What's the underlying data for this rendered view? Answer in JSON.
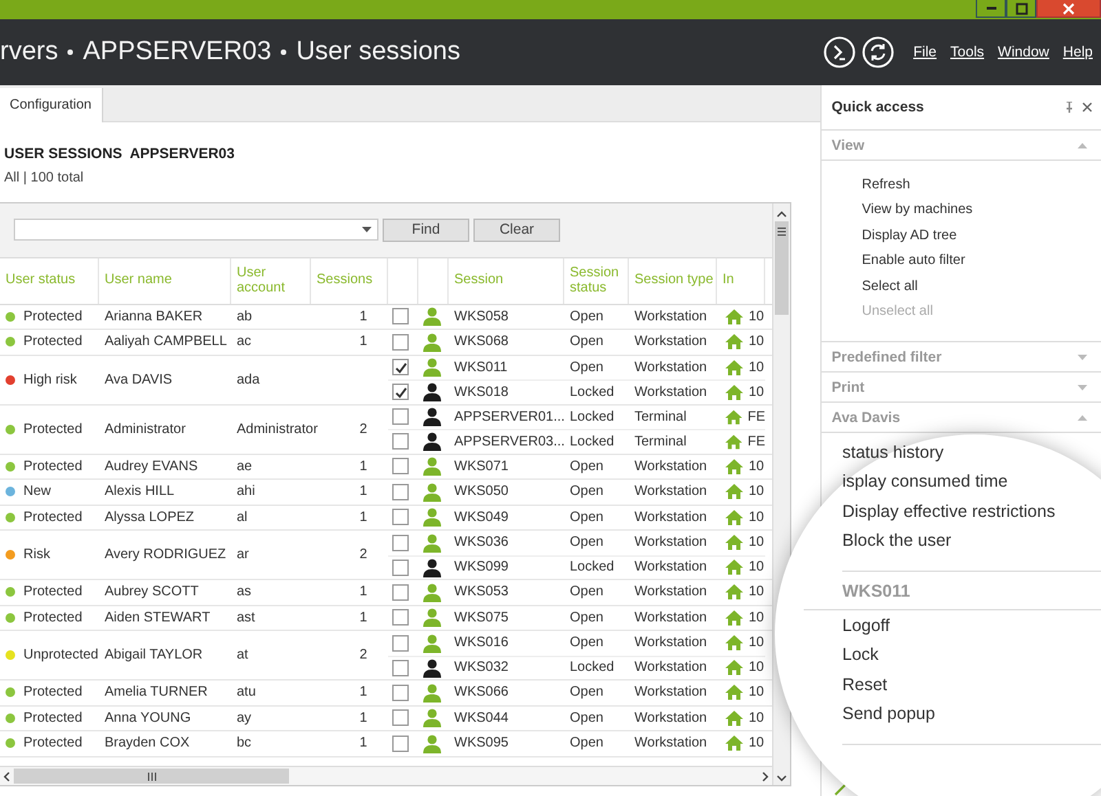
{
  "window": {
    "breadcrumb": [
      "rvers",
      "APPSERVER03",
      "User sessions"
    ],
    "menu": [
      "File",
      "Tools",
      "Window",
      "Help"
    ]
  },
  "tabs": [
    {
      "label": "Configuration",
      "selected": true
    }
  ],
  "heading": {
    "title": "USER SESSIONS",
    "server": "APPSERVER03",
    "summary": "All | 100 total"
  },
  "filter": {
    "find": "Find",
    "clear": "Clear"
  },
  "table": {
    "columns": [
      "User status",
      "User name",
      "User account",
      "Sessions",
      "Session",
      "Session status",
      "Session type",
      "In"
    ],
    "users": [
      {
        "status": "Protected",
        "color": "#8cc63f",
        "name": "Arianna BAKER",
        "account": "ab",
        "sessions_count": "1",
        "sessions": [
          {
            "checked": false,
            "locked": false,
            "session": "WKS058",
            "status": "Open",
            "type": "Workstation",
            "in": "10"
          }
        ]
      },
      {
        "status": "Protected",
        "color": "#8cc63f",
        "name": "Aaliyah CAMPBELL",
        "account": "ac",
        "sessions_count": "1",
        "sessions": [
          {
            "checked": false,
            "locked": false,
            "session": "WKS068",
            "status": "Open",
            "type": "Workstation",
            "in": "10"
          }
        ]
      },
      {
        "status": "High risk",
        "color": "#e2402f",
        "name": "Ava DAVIS",
        "account": "ada",
        "sessions": [
          {
            "checked": true,
            "locked": false,
            "session": "WKS011",
            "status": "Open",
            "type": "Workstation",
            "in": "10"
          },
          {
            "checked": true,
            "locked": true,
            "session": "WKS018",
            "status": "Locked",
            "type": "Workstation",
            "in": "10"
          }
        ]
      },
      {
        "status": "Protected",
        "color": "#8cc63f",
        "name": "Administrator",
        "account": "Administrator",
        "sessions_count": "2",
        "sessions": [
          {
            "checked": false,
            "locked": true,
            "session": "APPSERVER01...",
            "status": "Locked",
            "type": "Terminal",
            "in": "FE"
          },
          {
            "checked": false,
            "locked": true,
            "session": "APPSERVER03...",
            "status": "Locked",
            "type": "Terminal",
            "in": "FE"
          }
        ]
      },
      {
        "status": "Protected",
        "color": "#8cc63f",
        "name": "Audrey EVANS",
        "account": "ae",
        "sessions_count": "1",
        "sessions": [
          {
            "checked": false,
            "locked": false,
            "session": "WKS071",
            "status": "Open",
            "type": "Workstation",
            "in": "10"
          }
        ]
      },
      {
        "status": "New",
        "color": "#6cb4dd",
        "name": "Alexis HILL",
        "account": "ahi",
        "sessions_count": "1",
        "sessions": [
          {
            "checked": false,
            "locked": false,
            "session": "WKS050",
            "status": "Open",
            "type": "Workstation",
            "in": "10"
          }
        ]
      },
      {
        "status": "Protected",
        "color": "#8cc63f",
        "name": "Alyssa LOPEZ",
        "account": "al",
        "sessions_count": "1",
        "sessions": [
          {
            "checked": false,
            "locked": false,
            "session": "WKS049",
            "status": "Open",
            "type": "Workstation",
            "in": "10"
          }
        ]
      },
      {
        "status": "Risk",
        "color": "#f39c1f",
        "name": "Avery RODRIGUEZ",
        "account": "ar",
        "sessions_count": "2",
        "sessions": [
          {
            "checked": false,
            "locked": false,
            "session": "WKS036",
            "status": "Open",
            "type": "Workstation",
            "in": "10"
          },
          {
            "checked": false,
            "locked": true,
            "session": "WKS099",
            "status": "Locked",
            "type": "Workstation",
            "in": "10"
          }
        ]
      },
      {
        "status": "Protected",
        "color": "#8cc63f",
        "name": "Aubrey SCOTT",
        "account": "as",
        "sessions_count": "1",
        "sessions": [
          {
            "checked": false,
            "locked": false,
            "session": "WKS053",
            "status": "Open",
            "type": "Workstation",
            "in": "10"
          }
        ]
      },
      {
        "status": "Protected",
        "color": "#8cc63f",
        "name": "Aiden STEWART",
        "account": "ast",
        "sessions_count": "1",
        "sessions": [
          {
            "checked": false,
            "locked": false,
            "session": "WKS075",
            "status": "Open",
            "type": "Workstation",
            "in": "10"
          }
        ]
      },
      {
        "status": "Unprotected",
        "color": "#e6e21f",
        "name": "Abigail TAYLOR",
        "account": "at",
        "sessions_count": "2",
        "sessions": [
          {
            "checked": false,
            "locked": false,
            "session": "WKS016",
            "status": "Open",
            "type": "Workstation",
            "in": "10"
          },
          {
            "checked": false,
            "locked": true,
            "session": "WKS032",
            "status": "Locked",
            "type": "Workstation",
            "in": "10"
          }
        ]
      },
      {
        "status": "Protected",
        "color": "#8cc63f",
        "name": "Amelia TURNER",
        "account": "atu",
        "sessions_count": "1",
        "sessions": [
          {
            "checked": false,
            "locked": false,
            "session": "WKS066",
            "status": "Open",
            "type": "Workstation",
            "in": "10"
          }
        ]
      },
      {
        "status": "Protected",
        "color": "#8cc63f",
        "name": "Anna YOUNG",
        "account": "ay",
        "sessions_count": "1",
        "sessions": [
          {
            "checked": false,
            "locked": false,
            "session": "WKS044",
            "status": "Open",
            "type": "Workstation",
            "in": "10"
          }
        ]
      },
      {
        "status": "Protected",
        "color": "#8cc63f",
        "name": "Brayden COX",
        "account": "bc",
        "sessions_count": "1",
        "sessions": [
          {
            "checked": false,
            "locked": false,
            "session": "WKS095",
            "status": "Open",
            "type": "Workstation",
            "in": "10"
          }
        ]
      }
    ]
  },
  "quick_access": {
    "title": "Quick access",
    "sections": [
      {
        "title": "View",
        "expanded": true,
        "magnified": false,
        "items": [
          {
            "label": "Refresh",
            "disabled": false
          },
          {
            "label": "View by machines",
            "disabled": false
          },
          {
            "label": "Display AD tree",
            "disabled": false
          },
          {
            "label": "Enable auto filter",
            "disabled": false
          },
          {
            "label": "Select all",
            "disabled": false
          },
          {
            "label": "Unselect all",
            "disabled": true
          }
        ]
      },
      {
        "title": "Predefined filter",
        "expanded": false,
        "magnified": false
      },
      {
        "title": "Print",
        "expanded": false,
        "magnified": false
      },
      {
        "title": "Ava Davis",
        "expanded": true,
        "magnified": true,
        "items": [
          {
            "label": "status history",
            "disabled": false
          },
          {
            "label": "isplay consumed time",
            "disabled": false
          },
          {
            "label": "Display effective restrictions",
            "disabled": false
          },
          {
            "label": "Block the user",
            "disabled": false
          }
        ]
      },
      {
        "title": "WKS011",
        "expanded": true,
        "magnified": true,
        "items": [
          {
            "label": "Logoff",
            "disabled": false
          },
          {
            "label": "Lock",
            "disabled": false
          },
          {
            "label": "Reset",
            "disabled": false
          },
          {
            "label": "Send popup",
            "disabled": false
          }
        ]
      }
    ]
  }
}
